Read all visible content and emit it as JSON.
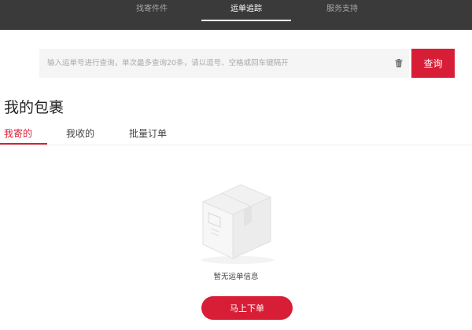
{
  "nav": {
    "tabs": [
      {
        "label": "找寄件件"
      },
      {
        "label": "运单追踪"
      },
      {
        "label": "服务支持"
      }
    ],
    "active_index": 1
  },
  "search": {
    "placeholder": "输入运单号进行查询，单次最多查询20条，请以逗号、空格或回车键隔开",
    "value": "",
    "button_label": "查询",
    "clear_icon": "trash-icon"
  },
  "page": {
    "title": "我的包裹"
  },
  "subtabs": {
    "items": [
      {
        "label": "我寄的"
      },
      {
        "label": "我收的"
      },
      {
        "label": "批量订单"
      }
    ],
    "active_index": 0
  },
  "empty_state": {
    "icon": "package-box-icon",
    "message": "暂无运单信息",
    "button_label": "马上下单"
  },
  "colors": {
    "brand_red": "#d81e36",
    "topbar_bg": "#3a3a3a",
    "search_bg": "#f5f5f5"
  }
}
